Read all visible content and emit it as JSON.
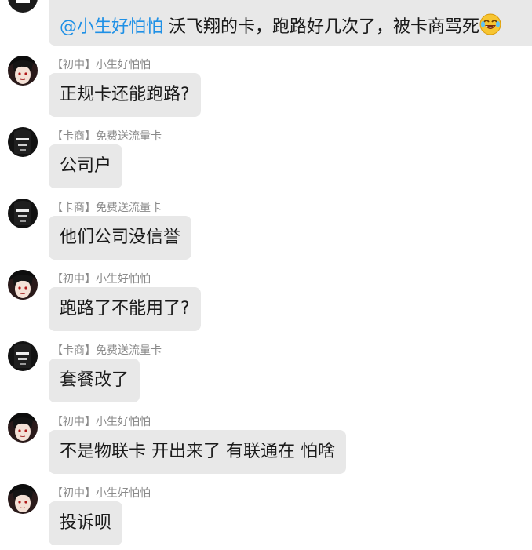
{
  "first_message": {
    "mention": "@小生好怕怕",
    "text": "沃飞翔的卡，跑路好几次了，被卡商骂死",
    "emoji": "laughing-crying"
  },
  "messages": [
    {
      "sender": "【初中】小生好怕怕",
      "text": "正规卡还能跑路?",
      "avatar": "anime-girl"
    },
    {
      "sender": "【卡商】免费送流量卡",
      "text": "公司户",
      "avatar": "dark-figure"
    },
    {
      "sender": "【卡商】免费送流量卡",
      "text": "他们公司没信誉",
      "avatar": "dark-figure"
    },
    {
      "sender": "【初中】小生好怕怕",
      "text": "跑路了不能用了?",
      "avatar": "anime-girl"
    },
    {
      "sender": "【卡商】免费送流量卡",
      "text": "套餐改了",
      "avatar": "dark-figure"
    },
    {
      "sender": "【初中】小生好怕怕",
      "text": "不是物联卡 开出来了 有联通在 怕啥",
      "avatar": "anime-girl"
    },
    {
      "sender": "【初中】小生好怕怕",
      "text": "投诉呗",
      "avatar": "anime-girl"
    }
  ],
  "colors": {
    "bubble": "#e8e8e8",
    "mention": "#1e90e6",
    "sender": "#8a8a8a",
    "text": "#1a1a1a"
  }
}
